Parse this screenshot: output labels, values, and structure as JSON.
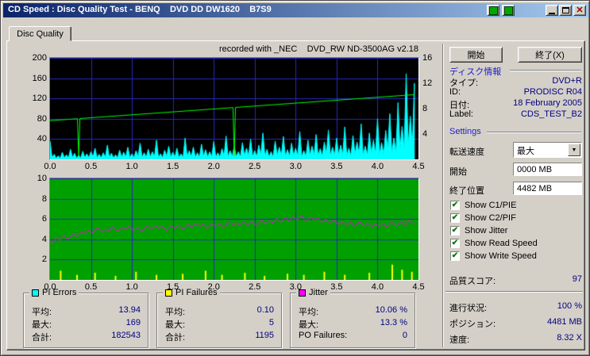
{
  "window": {
    "title": "CD Speed : Disc Quality Test - BENQ    DVD DD DW1620    B7S9"
  },
  "tab": {
    "label": "Disc Quality"
  },
  "glyphs": {
    "check": "✔",
    "dropdown": "▼",
    "close": "✕"
  },
  "charts": {
    "recorded_with": "recorded with _NEC    DVD_RW ND-3500AG v2.18"
  },
  "buttons": {
    "start": "開始",
    "exit": "終了(X)"
  },
  "disc_info": {
    "header": "ディスク情報",
    "rows": [
      {
        "label": "タイプ:",
        "value": "DVD+R"
      },
      {
        "label": "ID:",
        "value": "PRODISC R04"
      },
      {
        "label": "日付:",
        "value": "18 February 2005"
      },
      {
        "label": "Label:",
        "value": "CDS_TEST_B2"
      }
    ]
  },
  "settings": {
    "header": "Settings",
    "transfer_speed_label": "転送速度",
    "transfer_speed_value": "最大",
    "start_label": "開始",
    "start_value": "0000 MB",
    "end_label": "終了位置",
    "end_value": "4482 MB",
    "checkboxes": [
      {
        "label": "Show C1/PIE",
        "checked": true
      },
      {
        "label": "Show C2/PIF",
        "checked": true
      },
      {
        "label": "Show Jitter",
        "checked": true
      },
      {
        "label": "Show Read Speed",
        "checked": true
      },
      {
        "label": "Show Write Speed",
        "checked": true
      }
    ]
  },
  "quality": {
    "label": "品質スコア:",
    "value": "97"
  },
  "progress": [
    {
      "label": "進行状況:",
      "value": "100 %"
    },
    {
      "label": "ポジション:",
      "value": "4481 MB"
    },
    {
      "label": "速度:",
      "value": "8.32 X"
    }
  ],
  "stats_boxes": [
    {
      "title": "PI Errors",
      "swatch": "#00FFFF",
      "rows": [
        {
          "label": "平均:",
          "value": "13.94"
        },
        {
          "label": "最大:",
          "value": "169"
        },
        {
          "label": "合計:",
          "value": "182543"
        }
      ]
    },
    {
      "title": "PI Failures",
      "swatch": "#FFFF00",
      "rows": [
        {
          "label": "平均:",
          "value": "0.10"
        },
        {
          "label": "最大:",
          "value": "5"
        },
        {
          "label": "合計:",
          "value": "1195"
        }
      ]
    },
    {
      "title": "Jitter",
      "swatch": "#FF00FF",
      "rows": [
        {
          "label": "平均:",
          "value": "10.06 %"
        },
        {
          "label": "最大:",
          "value": "13.3 %"
        },
        {
          "label": "PO Failures:",
          "value": "0"
        }
      ]
    }
  ],
  "chart_data": [
    {
      "type": "area",
      "title": "PI Errors / Write Speed",
      "x_max": 4.5,
      "x_label_ticks": [
        "0.0",
        "0.5",
        "1.0",
        "1.5",
        "2.0",
        "2.5",
        "3.0",
        "3.5",
        "4.0",
        "4.5"
      ],
      "left_axis": {
        "min": 0,
        "max": 200,
        "ticks": [
          200,
          160,
          120,
          80,
          40
        ]
      },
      "right_axis": {
        "min": 0,
        "max": 16,
        "ticks": [
          16,
          12,
          8,
          4
        ]
      },
      "bg": "#000000",
      "grid_color": "#2828C0",
      "series": [
        {
          "name": "PI Errors",
          "color": "#00FFFF",
          "style": "spike-area",
          "x_step": 0.05,
          "values": [
            36,
            10,
            7,
            14,
            9,
            20,
            12,
            8,
            16,
            11,
            15,
            22,
            10,
            13,
            28,
            12,
            9,
            18,
            14,
            24,
            11,
            17,
            32,
            13,
            20,
            15,
            38,
            11,
            18,
            26,
            14,
            22,
            11,
            42,
            17,
            24,
            13,
            30,
            19,
            15,
            35,
            13,
            21,
            46,
            17,
            26,
            15,
            33,
            22,
            40,
            17,
            28,
            52,
            20,
            15,
            36,
            24,
            45,
            19,
            32,
            22,
            55,
            17,
            38,
            26,
            49,
            21,
            34,
            58,
            24,
            42,
            28,
            64,
            22,
            47,
            34,
            70,
            26,
            52,
            38,
            80,
            33,
            57,
            90,
            42,
            112,
            65,
            169,
            85,
            150
          ]
        },
        {
          "name": "Write Speed",
          "color": "#00FF00",
          "style": "line",
          "axis": "right",
          "points_x": [
            0,
            4.45
          ],
          "points_y": [
            6.1,
            10.2
          ],
          "dips_x": [
            0.35,
            2.25
          ],
          "dip_y": 0.5
        }
      ]
    },
    {
      "type": "line",
      "title": "PI Failures / Jitter",
      "x_max": 4.5,
      "left_axis": {
        "min": 0,
        "max": 10,
        "ticks": [
          10,
          8,
          6,
          4,
          2
        ]
      },
      "bg": "#00A000",
      "grid_color": "#2828C0",
      "series": [
        {
          "name": "PI Failures",
          "color": "#FFFF00",
          "style": "bars",
          "spikes_x": [
            0.13,
            0.33,
            0.55,
            0.8,
            1.05,
            1.3,
            1.62,
            1.9,
            2.1,
            2.38,
            2.62,
            2.9,
            3.1,
            3.35,
            3.6,
            3.9,
            4.18,
            4.3,
            4.42
          ],
          "spikes_h": [
            0.9,
            0.5,
            0.7,
            0.4,
            0.8,
            0.5,
            0.6,
            0.9,
            0.5,
            0.7,
            0.4,
            0.6,
            0.5,
            0.8,
            0.5,
            0.7,
            1.5,
            1.0,
            0.8
          ]
        },
        {
          "name": "Jitter",
          "color": "#FF00FF",
          "style": "line",
          "x_step": 0.05,
          "values": [
            3.8,
            3.9,
            4.0,
            4.2,
            4.1,
            4.3,
            4.5,
            4.4,
            4.6,
            4.8,
            4.7,
            4.9,
            5.0,
            4.8,
            4.9,
            5.1,
            5.0,
            4.9,
            5.1,
            5.2,
            5.0,
            5.1,
            4.9,
            5.0,
            5.2,
            5.1,
            5.3,
            5.2,
            5.0,
            5.1,
            5.2,
            5.3,
            5.1,
            5.2,
            5.4,
            5.3,
            5.5,
            5.4,
            5.2,
            5.3,
            5.4,
            5.5,
            5.3,
            5.4,
            5.6,
            5.5,
            5.4,
            5.6,
            5.5,
            5.7,
            5.5,
            5.6,
            5.8,
            5.6,
            5.7,
            5.9,
            5.8,
            6.0,
            5.9,
            6.1,
            6.0,
            6.2,
            6.0,
            5.9,
            6.1,
            6.0,
            5.8,
            5.9,
            5.7,
            5.8,
            5.6,
            5.7,
            5.5,
            5.6,
            5.4,
            5.5,
            5.6,
            5.4,
            5.5,
            5.3,
            5.4,
            5.5,
            5.3,
            5.5,
            5.6,
            5.4,
            5.7,
            5.5,
            5.8,
            5.6
          ]
        }
      ]
    }
  ]
}
